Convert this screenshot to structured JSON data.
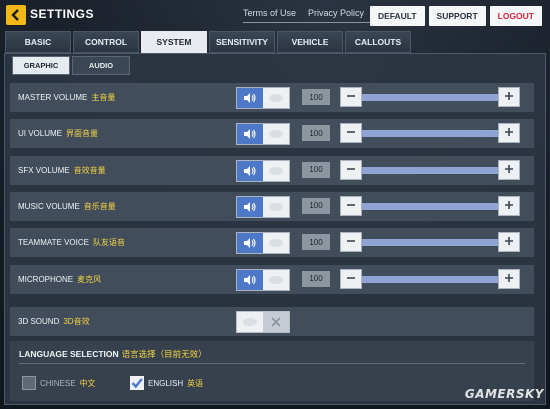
{
  "header": {
    "title": "SETTINGS",
    "links": [
      "Terms of Use",
      "Privacy Policy"
    ],
    "buttons": {
      "default": "DEFAULT",
      "support": "SUPPORT",
      "logout": "LOGOUT"
    }
  },
  "main_tabs": [
    {
      "label": "BASIC",
      "active": false
    },
    {
      "label": "CONTROL",
      "active": false
    },
    {
      "label": "SYSTEM",
      "active": true
    },
    {
      "label": "SENSITIVITY",
      "active": false
    },
    {
      "label": "VEHICLE",
      "active": false
    },
    {
      "label": "CALLOUTS",
      "active": false
    }
  ],
  "sub_tabs": [
    {
      "label": "GRAPHIC",
      "active": true
    },
    {
      "label": "AUDIO",
      "active": false
    }
  ],
  "audio_rows": [
    {
      "label": "MASTER VOLUME",
      "cn": "主音量",
      "enabled": true,
      "value": "100",
      "level": 1.0
    },
    {
      "label": "UI VOLUME",
      "cn": "界面音量",
      "enabled": true,
      "value": "100",
      "level": 1.0
    },
    {
      "label": "SFX VOLUME",
      "cn": "音效音量",
      "enabled": true,
      "value": "100",
      "level": 1.0
    },
    {
      "label": "MUSIC VOLUME",
      "cn": "音乐音量",
      "enabled": true,
      "value": "100",
      "level": 1.0
    },
    {
      "label": "TEAMMATE VOICE",
      "cn": "队友语音",
      "enabled": true,
      "value": "100",
      "level": 1.0
    },
    {
      "label": "MICROPHONE",
      "cn": "麦克风",
      "enabled": true,
      "value": "100",
      "level": 1.0
    }
  ],
  "sound3d": {
    "label": "3D SOUND",
    "cn": "3D音效",
    "enabled": false
  },
  "language": {
    "title": "LANGUAGE SELECTION",
    "title_cn": "语言选择（目前无效）",
    "options": [
      {
        "label": "CHINESE",
        "cn": "中文",
        "checked": false
      },
      {
        "label": "ENGLISH",
        "cn": "英语",
        "checked": true
      }
    ]
  },
  "watermark": "GAMERSKY",
  "colors": {
    "accent": "#f2b81a",
    "toggle_on": "#4d78c7",
    "slider_fill": "#8fa4d4",
    "cn_text": "#f5d442",
    "logout": "#d7263d"
  },
  "icons": {
    "back": "chevron-left-icon",
    "speaker": "speaker-icon",
    "minus": "minus-icon",
    "plus": "plus-icon",
    "close": "close-icon",
    "check": "check-icon"
  }
}
